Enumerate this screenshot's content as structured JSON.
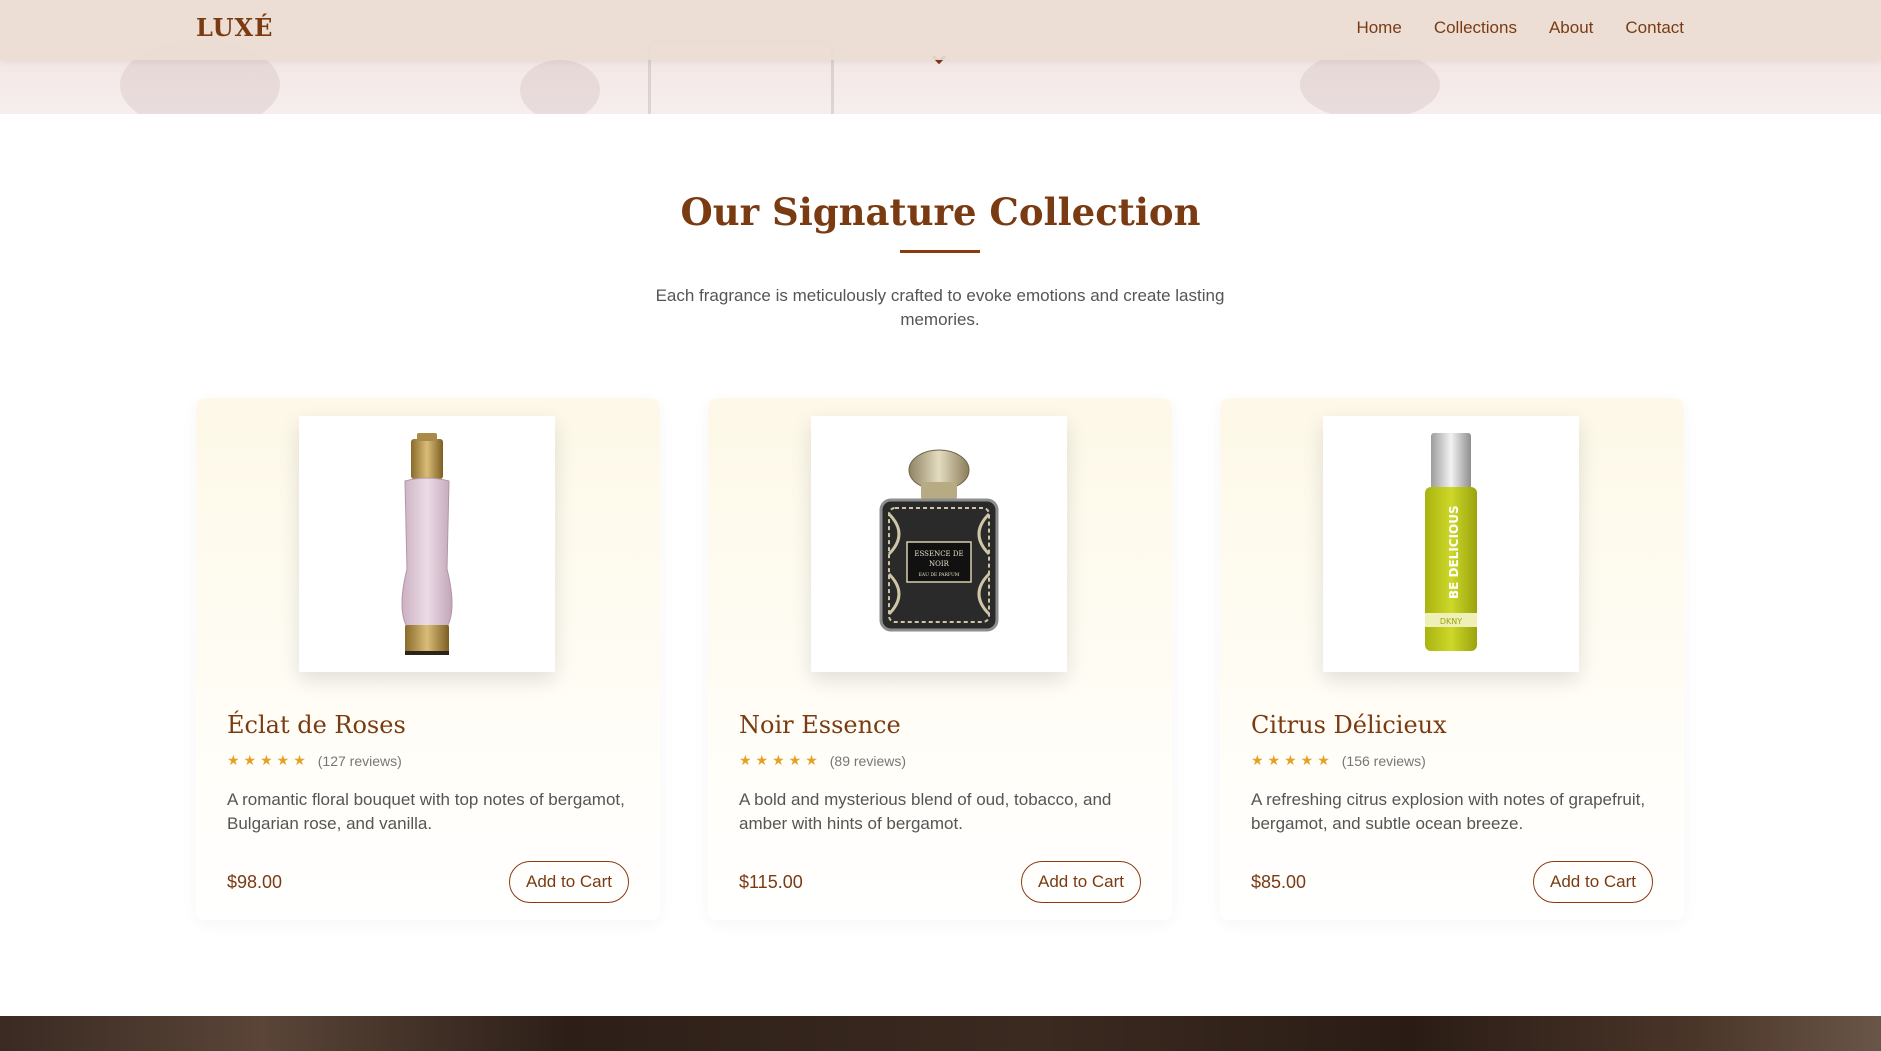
{
  "nav": {
    "logo": "LUXÉ",
    "links": [
      "Home",
      "Collections",
      "About",
      "Contact"
    ]
  },
  "section": {
    "title": "Our Signature Collection",
    "subtitle": "Each fragrance is meticulously crafted to evoke emotions and create lasting memories."
  },
  "products": [
    {
      "name": "Éclat de Roses",
      "stars": "★★★★★",
      "reviews": "(127 reviews)",
      "description": "A romantic floral bouquet with top notes of bergamot, Bulgarian rose, and vanilla.",
      "price": "$98.00",
      "button": "Add to Cart"
    },
    {
      "name": "Noir Essence",
      "stars": "★★★★★",
      "reviews": "(89 reviews)",
      "description": "A bold and mysterious blend of oud, tobacco, and amber with hints of bergamot.",
      "price": "$115.00",
      "button": "Add to Cart",
      "bottle_label": [
        "ESSENCE DE",
        "NOIR",
        "EAU DE PARFUM"
      ]
    },
    {
      "name": "Citrus Délicieux",
      "stars": "★★★★★",
      "reviews": "(156 reviews)",
      "description": "A refreshing citrus explosion with notes of grapefruit, bergamot, and subtle ocean breeze.",
      "price": "$85.00",
      "button": "Add to Cart",
      "bottle_label": [
        "BE DELICIOUS",
        "DKNY"
      ]
    }
  ],
  "colors": {
    "brand": "#7a3b12",
    "star": "#e6a120"
  }
}
